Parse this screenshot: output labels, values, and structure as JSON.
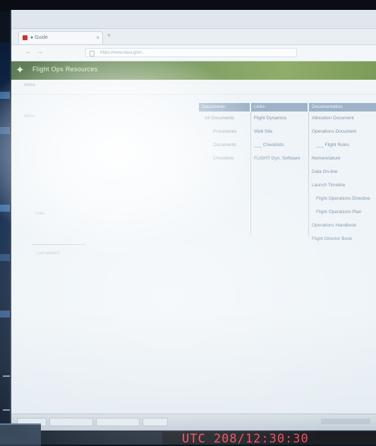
{
  "browser": {
    "tab_title": "● Guide",
    "tab_close": "×",
    "new_tab": "+",
    "back": "←",
    "forward": "→",
    "address": "https://www.nasa.gov/..."
  },
  "site": {
    "logo": "✦",
    "title": "Flight Ops Resources",
    "breadcrumb": "Home"
  },
  "side_panel": {
    "top_label": "Menu",
    "mid_label": "Links",
    "footer_note": "Last updated"
  },
  "table": {
    "headers": [
      "Documents",
      "Links",
      "Documentation"
    ],
    "col1": [
      "All Documents",
      "Procedures",
      "Documents",
      "Checklists"
    ],
    "col2": [
      "Flight Dynamics",
      "Web Site",
      "___ Checklists",
      "FLIGHT Dyn. Software"
    ],
    "col3": [
      "Allocation Document",
      "Operations Document",
      "___ Flight Rules",
      "Nomenclature",
      "Data On-line",
      "Launch Timeline",
      "Flight Operations Directive",
      "Flight Operations Plan",
      "Operations Handbook",
      "Flight Director Book"
    ]
  },
  "environment": {
    "clock": "UTC 208/12:30:30"
  },
  "colors": {
    "header_green": "#7a9a62",
    "table_header": "#9db3c9",
    "clock_red": "#ff3b4a"
  }
}
